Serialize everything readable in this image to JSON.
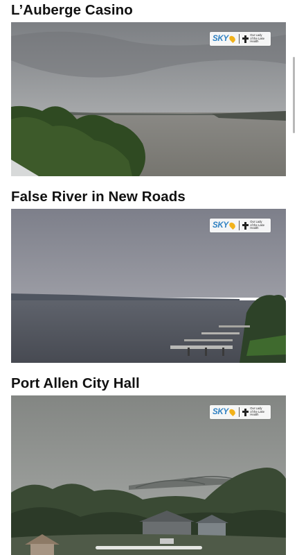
{
  "cameras": [
    {
      "title": "L’Auberge Casino",
      "logo": {
        "brand": "SKY",
        "sponsor_lines": [
          "Our Lady",
          "of the Lake",
          "Health"
        ]
      }
    },
    {
      "title": "False River in New Roads",
      "logo": {
        "brand": "SKY",
        "sponsor_lines": [
          "Our Lady",
          "of the Lake",
          "Health"
        ]
      }
    },
    {
      "title": "Port Allen City Hall",
      "logo": {
        "brand": "SKY",
        "sponsor_lines": [
          "Our Lady",
          "of the Lake",
          "Health"
        ]
      }
    }
  ],
  "colors": {
    "sky_brand": "#2d7fc1",
    "sky_nine": "#f2b21b",
    "title_text": "#111111"
  }
}
